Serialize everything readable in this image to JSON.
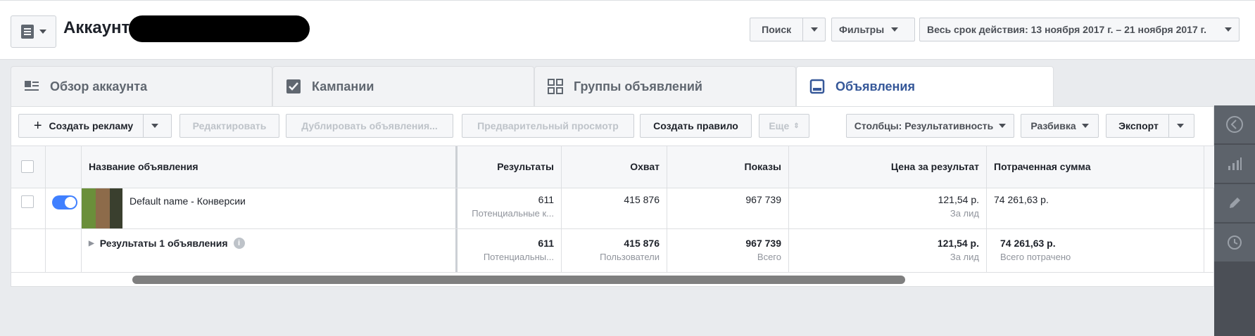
{
  "header": {
    "account_label": "Аккаунт:",
    "search_label": "Поиск",
    "filters_label": "Фильтры",
    "date_range_label": "Весь срок действия: 13 ноября 2017 г. – 21 ноября 2017 г."
  },
  "tabs": [
    {
      "label": "Обзор аккаунта",
      "icon": "account-overview-icon"
    },
    {
      "label": "Кампании",
      "icon": "checkbox-icon"
    },
    {
      "label": "Группы объявлений",
      "icon": "grid-icon"
    },
    {
      "label": "Объявления",
      "icon": "ad-icon",
      "active": true
    }
  ],
  "toolbar": {
    "create_ad": "Создать рекламу",
    "edit": "Редактировать",
    "duplicate": "Дублировать объявления...",
    "preview": "Предварительный просмотр",
    "create_rule": "Создать правило",
    "more": "Еще",
    "columns": "Столбцы: Результативность",
    "breakdown": "Разбивка",
    "export": "Экспорт"
  },
  "table": {
    "headers": {
      "name": "Название объявления",
      "results": "Результаты",
      "reach": "Охват",
      "impressions": "Показы",
      "cost_per_result": "Цена за результат",
      "amount_spent": "Потраченная сумма"
    },
    "row": {
      "name": "Default name - Конверсии",
      "results": "611",
      "results_sub": "Потенциальные к...",
      "reach": "415 876",
      "impressions": "967 739",
      "cost_per_result": "121,54 р.",
      "cost_per_result_sub": "За лид",
      "amount_spent": "74 261,63 р.",
      "enabled": true
    },
    "summary": {
      "label": "Результаты 1 объявления",
      "results": "611",
      "results_sub": "Потенциальны...",
      "reach": "415 876",
      "reach_sub": "Пользователи",
      "impressions": "967 739",
      "impressions_sub": "Всего",
      "cost_per_result": "121,54 р.",
      "cost_per_result_sub": "За лид",
      "amount_spent": "74 261,63 р.",
      "amount_spent_sub": "Всего потрачено"
    }
  },
  "colors": {
    "accent": "#4080ff",
    "active_tab_text": "#365899",
    "rail_bg": "#4b4f56"
  }
}
